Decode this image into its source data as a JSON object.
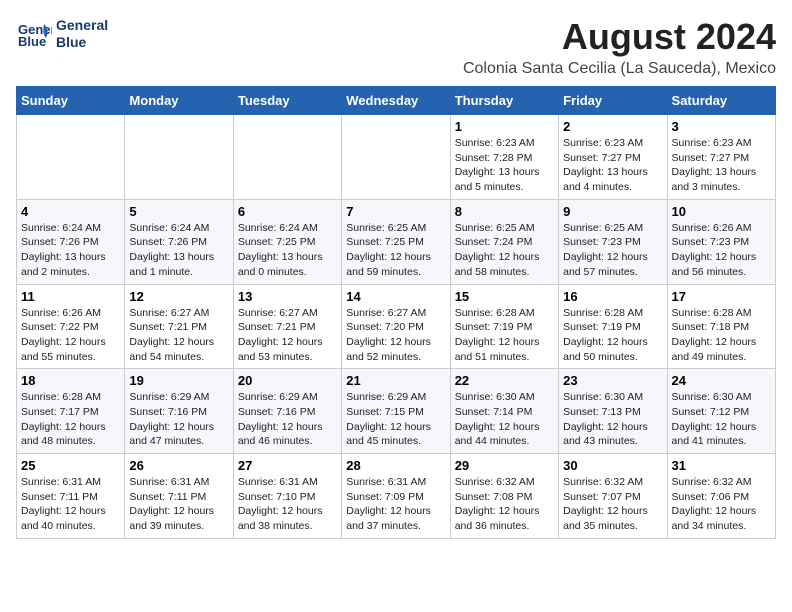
{
  "header": {
    "logo_line1": "General",
    "logo_line2": "Blue",
    "month": "August 2024",
    "location": "Colonia Santa Cecilia (La Sauceda), Mexico"
  },
  "weekdays": [
    "Sunday",
    "Monday",
    "Tuesday",
    "Wednesday",
    "Thursday",
    "Friday",
    "Saturday"
  ],
  "weeks": [
    [
      {
        "day": "",
        "info": ""
      },
      {
        "day": "",
        "info": ""
      },
      {
        "day": "",
        "info": ""
      },
      {
        "day": "",
        "info": ""
      },
      {
        "day": "1",
        "info": "Sunrise: 6:23 AM\nSunset: 7:28 PM\nDaylight: 13 hours\nand 5 minutes."
      },
      {
        "day": "2",
        "info": "Sunrise: 6:23 AM\nSunset: 7:27 PM\nDaylight: 13 hours\nand 4 minutes."
      },
      {
        "day": "3",
        "info": "Sunrise: 6:23 AM\nSunset: 7:27 PM\nDaylight: 13 hours\nand 3 minutes."
      }
    ],
    [
      {
        "day": "4",
        "info": "Sunrise: 6:24 AM\nSunset: 7:26 PM\nDaylight: 13 hours\nand 2 minutes."
      },
      {
        "day": "5",
        "info": "Sunrise: 6:24 AM\nSunset: 7:26 PM\nDaylight: 13 hours\nand 1 minute."
      },
      {
        "day": "6",
        "info": "Sunrise: 6:24 AM\nSunset: 7:25 PM\nDaylight: 13 hours\nand 0 minutes."
      },
      {
        "day": "7",
        "info": "Sunrise: 6:25 AM\nSunset: 7:25 PM\nDaylight: 12 hours\nand 59 minutes."
      },
      {
        "day": "8",
        "info": "Sunrise: 6:25 AM\nSunset: 7:24 PM\nDaylight: 12 hours\nand 58 minutes."
      },
      {
        "day": "9",
        "info": "Sunrise: 6:25 AM\nSunset: 7:23 PM\nDaylight: 12 hours\nand 57 minutes."
      },
      {
        "day": "10",
        "info": "Sunrise: 6:26 AM\nSunset: 7:23 PM\nDaylight: 12 hours\nand 56 minutes."
      }
    ],
    [
      {
        "day": "11",
        "info": "Sunrise: 6:26 AM\nSunset: 7:22 PM\nDaylight: 12 hours\nand 55 minutes."
      },
      {
        "day": "12",
        "info": "Sunrise: 6:27 AM\nSunset: 7:21 PM\nDaylight: 12 hours\nand 54 minutes."
      },
      {
        "day": "13",
        "info": "Sunrise: 6:27 AM\nSunset: 7:21 PM\nDaylight: 12 hours\nand 53 minutes."
      },
      {
        "day": "14",
        "info": "Sunrise: 6:27 AM\nSunset: 7:20 PM\nDaylight: 12 hours\nand 52 minutes."
      },
      {
        "day": "15",
        "info": "Sunrise: 6:28 AM\nSunset: 7:19 PM\nDaylight: 12 hours\nand 51 minutes."
      },
      {
        "day": "16",
        "info": "Sunrise: 6:28 AM\nSunset: 7:19 PM\nDaylight: 12 hours\nand 50 minutes."
      },
      {
        "day": "17",
        "info": "Sunrise: 6:28 AM\nSunset: 7:18 PM\nDaylight: 12 hours\nand 49 minutes."
      }
    ],
    [
      {
        "day": "18",
        "info": "Sunrise: 6:28 AM\nSunset: 7:17 PM\nDaylight: 12 hours\nand 48 minutes."
      },
      {
        "day": "19",
        "info": "Sunrise: 6:29 AM\nSunset: 7:16 PM\nDaylight: 12 hours\nand 47 minutes."
      },
      {
        "day": "20",
        "info": "Sunrise: 6:29 AM\nSunset: 7:16 PM\nDaylight: 12 hours\nand 46 minutes."
      },
      {
        "day": "21",
        "info": "Sunrise: 6:29 AM\nSunset: 7:15 PM\nDaylight: 12 hours\nand 45 minutes."
      },
      {
        "day": "22",
        "info": "Sunrise: 6:30 AM\nSunset: 7:14 PM\nDaylight: 12 hours\nand 44 minutes."
      },
      {
        "day": "23",
        "info": "Sunrise: 6:30 AM\nSunset: 7:13 PM\nDaylight: 12 hours\nand 43 minutes."
      },
      {
        "day": "24",
        "info": "Sunrise: 6:30 AM\nSunset: 7:12 PM\nDaylight: 12 hours\nand 41 minutes."
      }
    ],
    [
      {
        "day": "25",
        "info": "Sunrise: 6:31 AM\nSunset: 7:11 PM\nDaylight: 12 hours\nand 40 minutes."
      },
      {
        "day": "26",
        "info": "Sunrise: 6:31 AM\nSunset: 7:11 PM\nDaylight: 12 hours\nand 39 minutes."
      },
      {
        "day": "27",
        "info": "Sunrise: 6:31 AM\nSunset: 7:10 PM\nDaylight: 12 hours\nand 38 minutes."
      },
      {
        "day": "28",
        "info": "Sunrise: 6:31 AM\nSunset: 7:09 PM\nDaylight: 12 hours\nand 37 minutes."
      },
      {
        "day": "29",
        "info": "Sunrise: 6:32 AM\nSunset: 7:08 PM\nDaylight: 12 hours\nand 36 minutes."
      },
      {
        "day": "30",
        "info": "Sunrise: 6:32 AM\nSunset: 7:07 PM\nDaylight: 12 hours\nand 35 minutes."
      },
      {
        "day": "31",
        "info": "Sunrise: 6:32 AM\nSunset: 7:06 PM\nDaylight: 12 hours\nand 34 minutes."
      }
    ]
  ]
}
